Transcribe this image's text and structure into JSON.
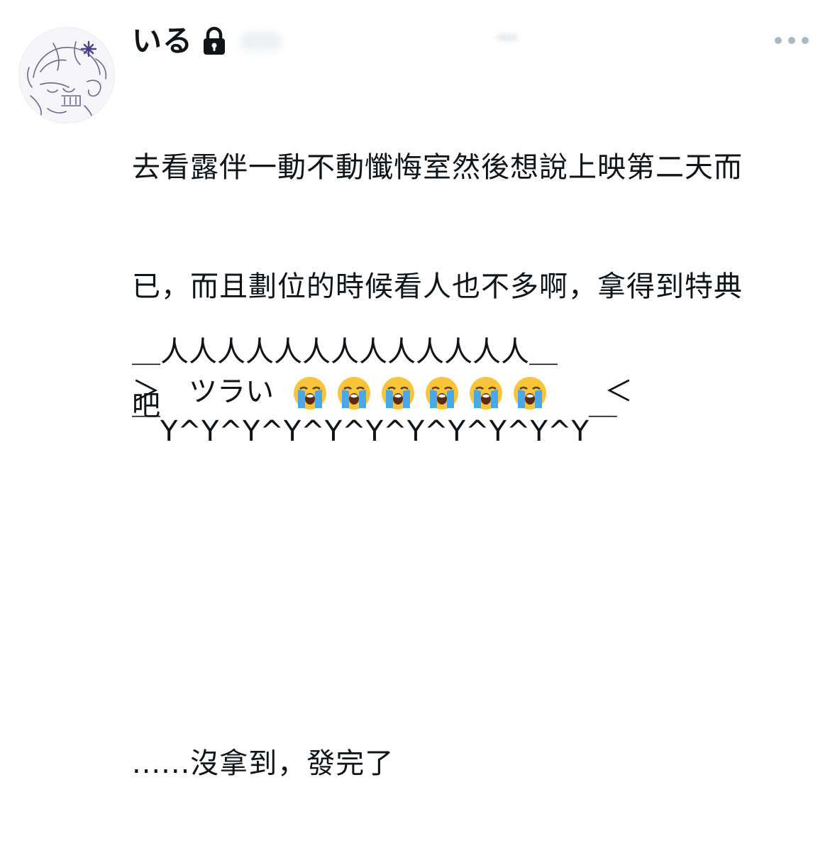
{
  "post": {
    "author": {
      "display_name": "いる",
      "verified_icon": "lock-icon"
    },
    "more_icon": "more-horizontal-icon",
    "text": {
      "line1": "去看露伴一動不動懺悔室然後想說上映第二天而",
      "line2": "已，而且劃位的時候看人也不多啊，拿得到特典",
      "line3": "吧",
      "line4": "......沒拿到，發完了"
    },
    "ascii_art": {
      "top": "＿人人人人人人人人人人人人人＿",
      "mid_left": "＞　ツラい",
      "mid_right": "＜",
      "bottom": "￣Y^Y^Y^Y^Y^Y^Y^Y^Y^Y^Y￣",
      "emoji_icon": "loudly-crying-face-icon",
      "emoji_count": 6
    }
  },
  "colors": {
    "text": "#0f1419",
    "muted": "#aab8c2",
    "emoji_face": "#f7c43a",
    "tears": "#4aa8e8"
  }
}
